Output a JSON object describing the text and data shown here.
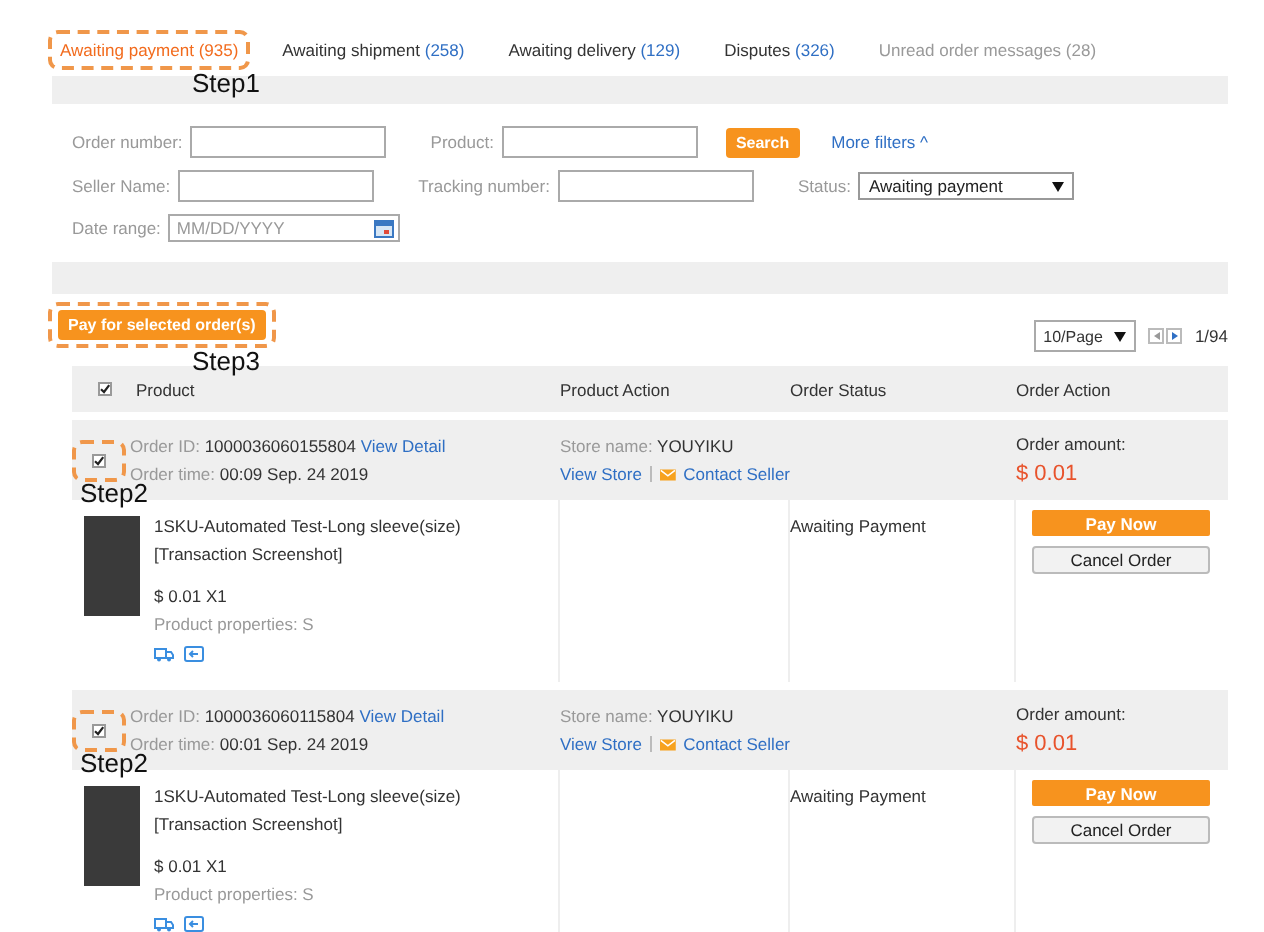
{
  "tabs": [
    {
      "label": "Awaiting payment",
      "count": "(935)",
      "selected": true,
      "muted": false,
      "step": "Step1"
    },
    {
      "label": "Awaiting shipment",
      "count": "(258)",
      "selected": false,
      "muted": false
    },
    {
      "label": "Awaiting delivery",
      "count": "(129)",
      "selected": false,
      "muted": false
    },
    {
      "label": "Disputes",
      "count": "(326)",
      "selected": false,
      "muted": false
    },
    {
      "label": "Unread order messages",
      "count": "(28)",
      "selected": false,
      "muted": true
    }
  ],
  "filters": {
    "order_number": {
      "label": "Order number:"
    },
    "product": {
      "label": "Product:"
    },
    "search_button": "Search",
    "more_filters": "More filters ^",
    "seller_name": {
      "label": "Seller Name:"
    },
    "tracking_number": {
      "label": "Tracking number:"
    },
    "status": {
      "label": "Status:",
      "value": "Awaiting payment"
    },
    "date_range": {
      "label": "Date range:",
      "placeholder": "MM/DD/YYYY"
    }
  },
  "toolbar": {
    "pay_selected_button": "Pay for selected order(s)",
    "step": "Step3",
    "page_size": "10/Page",
    "page": "1/94"
  },
  "table": {
    "select_all_checked": true,
    "columns": [
      "Product",
      "Product Action",
      "Order Status",
      "Order Action"
    ],
    "orders": [
      {
        "checked": true,
        "step": "Step2",
        "order_id_label": "Order ID:",
        "order_id": "1000036060155804",
        "view_detail": "View Detail",
        "order_time_label": "Order time:",
        "order_time": "00:09 Sep. 24 2019",
        "store_label": "Store name:",
        "store_name": "YOUYIKU",
        "view_store": "View Store",
        "contact_seller": "Contact Seller",
        "amount_label": "Order amount:",
        "amount": "$ 0.01",
        "item": {
          "title": "1SKU-Automated Test-Long sleeve(size)",
          "subtitle": "[Transaction Screenshot]",
          "price": "$ 0.01 X1",
          "properties": "Product properties: S",
          "status": "Awaiting Payment",
          "pay_button": "Pay Now",
          "cancel_button": "Cancel Order"
        }
      },
      {
        "checked": true,
        "step": "Step2",
        "order_id_label": "Order ID:",
        "order_id": "1000036060115804",
        "view_detail": "View Detail",
        "order_time_label": "Order time:",
        "order_time": "00:01 Sep. 24 2019",
        "store_label": "Store name:",
        "store_name": "YOUYIKU",
        "view_store": "View Store",
        "contact_seller": "Contact Seller",
        "amount_label": "Order amount:",
        "amount": "$ 0.01",
        "item": {
          "title": "1SKU-Automated Test-Long sleeve(size)",
          "subtitle": "[Transaction Screenshot]",
          "price": "$ 0.01 X1",
          "properties": "Product properties: S",
          "status": "Awaiting Payment",
          "pay_button": "Pay Now",
          "cancel_button": "Cancel Order"
        }
      }
    ]
  }
}
